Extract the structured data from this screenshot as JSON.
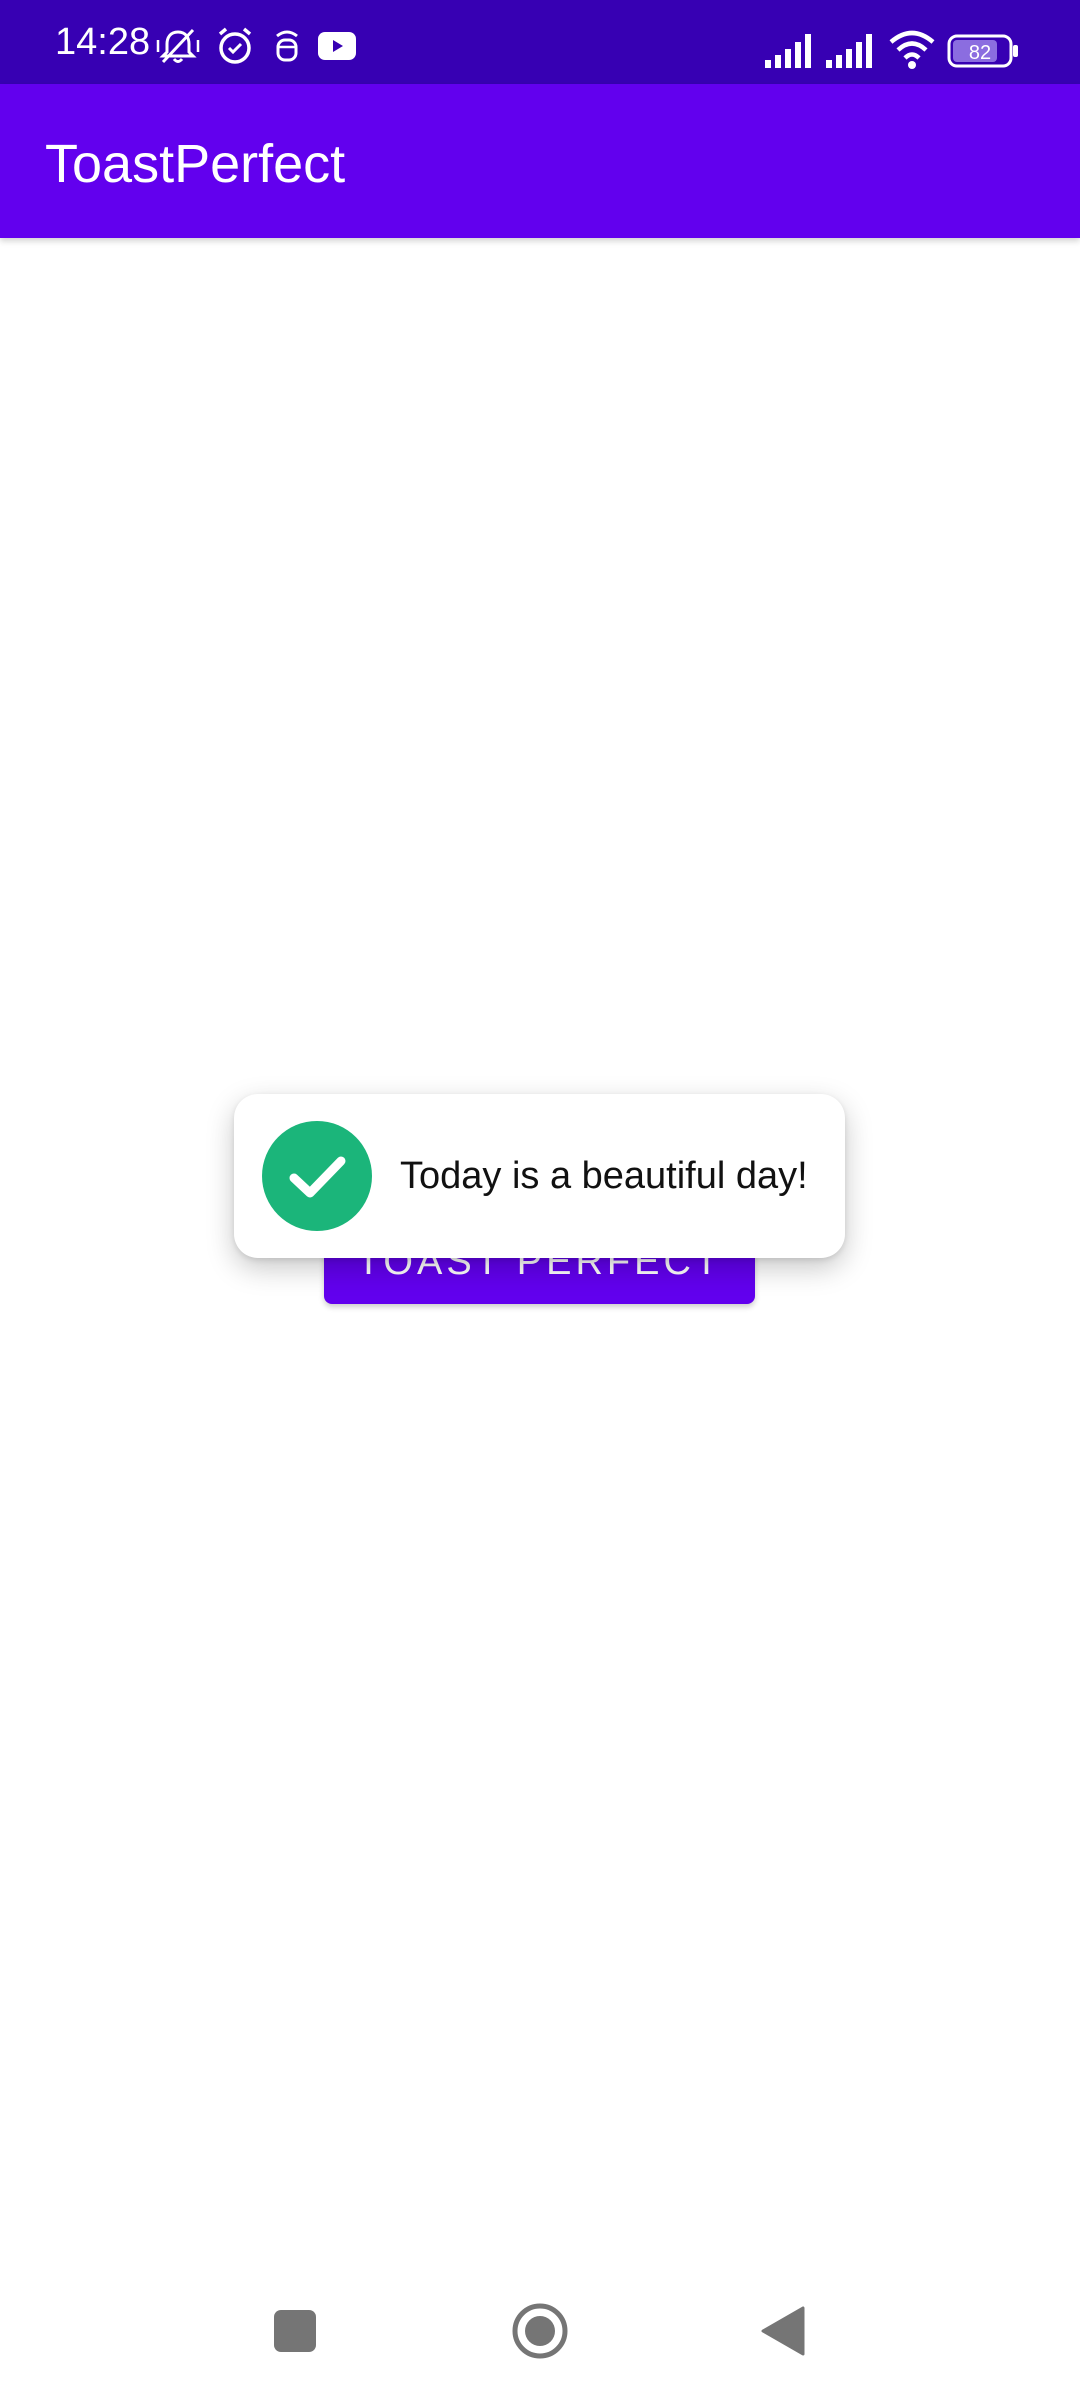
{
  "status_bar": {
    "time": "14:28",
    "battery_level": "82",
    "icons": [
      "vibrate-mute-icon",
      "alarm-icon",
      "notification-app-icon",
      "youtube-icon",
      "signal-icon",
      "signal-icon",
      "wifi-icon",
      "battery-icon"
    ]
  },
  "app_bar": {
    "title": "ToastPerfect"
  },
  "main": {
    "button_label": "TOAST PERFECT"
  },
  "toast": {
    "message": "Today is a beautiful day!",
    "icon": "check-circle-icon",
    "icon_color": "#1bb57a"
  },
  "nav_bar": {
    "items": [
      "recents-button",
      "home-button",
      "back-button"
    ]
  },
  "colors": {
    "status_bar": "#3700b3",
    "primary": "#6200ee",
    "background": "#ffffff"
  }
}
